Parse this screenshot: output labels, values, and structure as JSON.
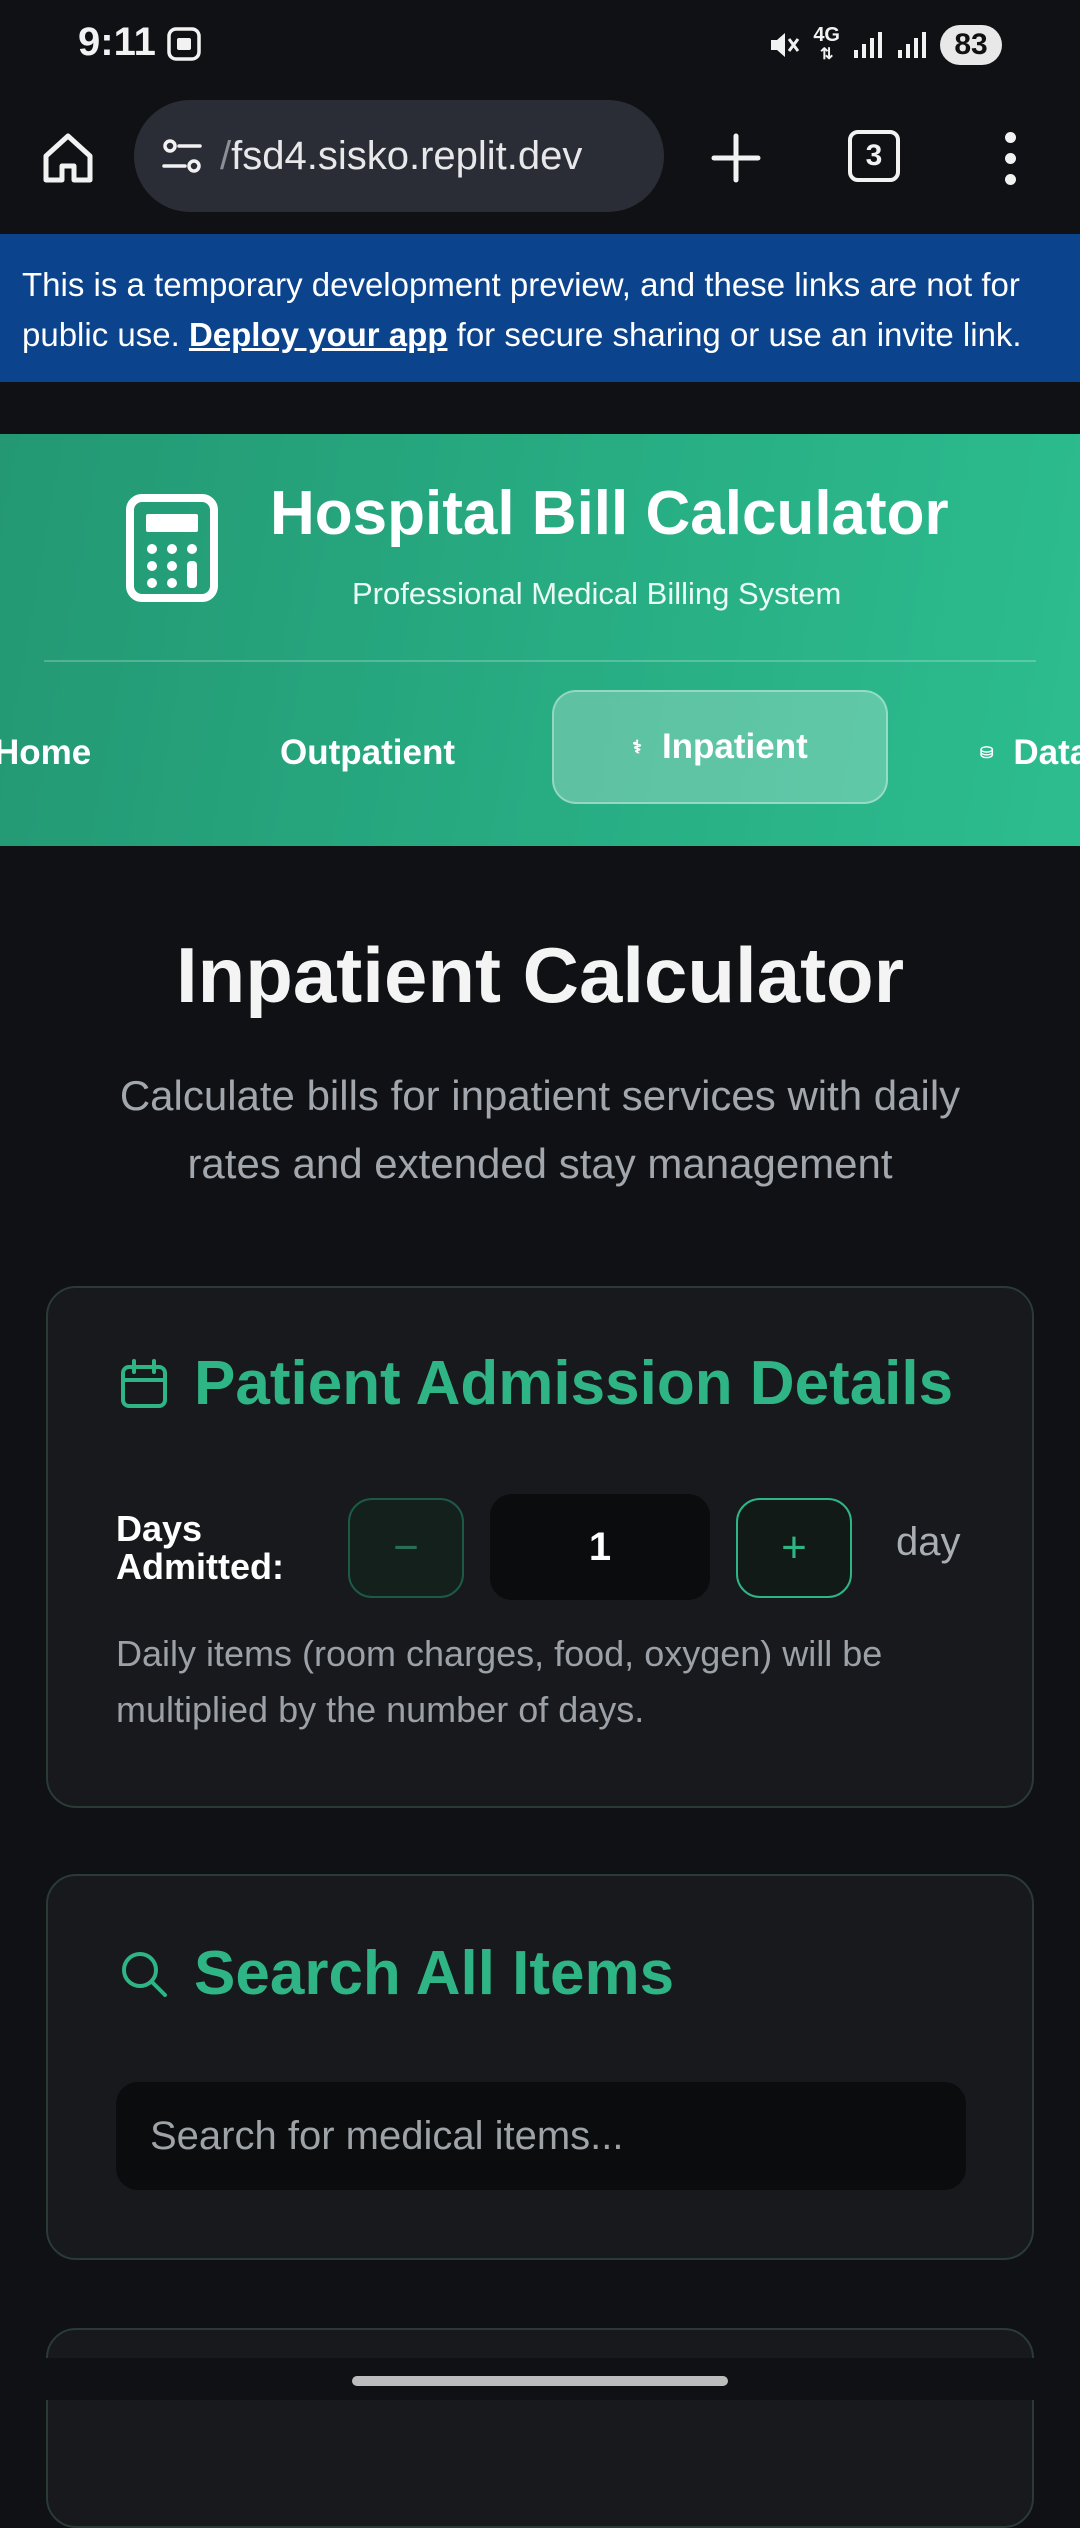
{
  "status_bar": {
    "time": "9:11",
    "network": "4G",
    "battery": "83",
    "icons": [
      "screenshot-icon",
      "mute-icon",
      "signal-icon",
      "signal-icon"
    ]
  },
  "browser": {
    "url_prefix": "/",
    "url": "fsd4.sisko.replit.dev",
    "tab_count": "3"
  },
  "dev_banner": {
    "text_before": "This is a temporary development preview, and these links are not for public use. ",
    "link_text": "Deploy your app",
    "text_after": " for secure sharing or use an invite link."
  },
  "header": {
    "title": "Hospital Bill Calculator",
    "subtitle": "Professional Medical Billing System",
    "nav": [
      {
        "label": "Home"
      },
      {
        "label": "Outpatient"
      },
      {
        "label": "Inpatient",
        "icon": "stethoscope-icon",
        "active": true
      },
      {
        "label": "Data",
        "icon": "database-icon"
      }
    ]
  },
  "page": {
    "title": "Inpatient Calculator",
    "description": "Calculate bills for inpatient services with daily rates and extended stay management"
  },
  "admission": {
    "title": "Patient Admission Details",
    "days_label_line1": "Days",
    "days_label_line2": "Admitted:",
    "decrement": "−",
    "increment": "+",
    "days_value": "1",
    "unit": "day",
    "note": "Daily items (room charges, food, oxygen) will be multiplied by the number of days."
  },
  "search": {
    "title": "Search All Items",
    "placeholder": "Search for medical items..."
  },
  "colors": {
    "accent": "#2fb585",
    "header_gradient_start": "#239873",
    "header_gradient_end": "#2cbd8e",
    "banner": "#0b438d",
    "background": "#101114"
  }
}
